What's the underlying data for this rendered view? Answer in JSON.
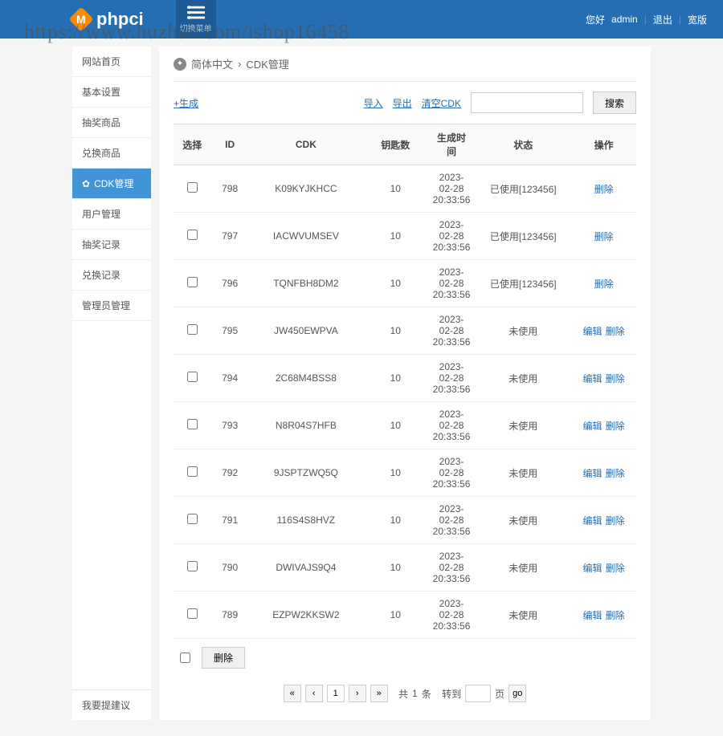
{
  "watermark": "https://www.huzhan.com/ishop16458",
  "header": {
    "logo_text": "phpci",
    "logo_icon": "M",
    "toggle_label": "切换菜单",
    "greeting": "您好",
    "username": "admin",
    "logout": "退出",
    "theme": "宽版"
  },
  "sidebar": {
    "items": [
      {
        "label": "网站首页"
      },
      {
        "label": "基本设置"
      },
      {
        "label": "抽奖商品"
      },
      {
        "label": "兑换商品"
      },
      {
        "label": "CDK管理",
        "active": true
      },
      {
        "label": "用户管理"
      },
      {
        "label": "抽奖记录"
      },
      {
        "label": "兑换记录"
      },
      {
        "label": "管理员管理"
      }
    ],
    "footer": "我要提建议"
  },
  "breadcrumb": {
    "root": "简体中文",
    "current": "CDK管理"
  },
  "toolbar": {
    "generate": "+生成",
    "import": "导入",
    "export": "导出",
    "clear": "清空CDK",
    "search_label": "搜索",
    "search_value": ""
  },
  "columns": {
    "select": "选择",
    "id": "ID",
    "cdk": "CDK",
    "keys": "钥匙数",
    "created": "生成时间",
    "status": "状态",
    "ops": "操作"
  },
  "rows": [
    {
      "id": "798",
      "cdk": "K09KYJKHCC",
      "keys": "10",
      "created": "2023-02-28 20:33:56",
      "status": "已使用[123456]",
      "ops": [
        "删除"
      ]
    },
    {
      "id": "797",
      "cdk": "IACWVUMSEV",
      "keys": "10",
      "created": "2023-02-28 20:33:56",
      "status": "已使用[123456]",
      "ops": [
        "删除"
      ]
    },
    {
      "id": "796",
      "cdk": "TQNFBH8DM2",
      "keys": "10",
      "created": "2023-02-28 20:33:56",
      "status": "已使用[123456]",
      "ops": [
        "删除"
      ]
    },
    {
      "id": "795",
      "cdk": "JW450EWPVA",
      "keys": "10",
      "created": "2023-02-28 20:33:56",
      "status": "未使用",
      "ops": [
        "编辑",
        "删除"
      ]
    },
    {
      "id": "794",
      "cdk": "2C68M4BSS8",
      "keys": "10",
      "created": "2023-02-28 20:33:56",
      "status": "未使用",
      "ops": [
        "编辑",
        "删除"
      ]
    },
    {
      "id": "793",
      "cdk": "N8R04S7HFB",
      "keys": "10",
      "created": "2023-02-28 20:33:56",
      "status": "未使用",
      "ops": [
        "编辑",
        "删除"
      ]
    },
    {
      "id": "792",
      "cdk": "9JSPTZWQ5Q",
      "keys": "10",
      "created": "2023-02-28 20:33:56",
      "status": "未使用",
      "ops": [
        "编辑",
        "删除"
      ]
    },
    {
      "id": "791",
      "cdk": "116S4S8HVZ",
      "keys": "10",
      "created": "2023-02-28 20:33:56",
      "status": "未使用",
      "ops": [
        "编辑",
        "删除"
      ]
    },
    {
      "id": "790",
      "cdk": "DWIVAJS9Q4",
      "keys": "10",
      "created": "2023-02-28 20:33:56",
      "status": "未使用",
      "ops": [
        "编辑",
        "删除"
      ]
    },
    {
      "id": "789",
      "cdk": "EZPW2KKSW2",
      "keys": "10",
      "created": "2023-02-28 20:33:56",
      "status": "未使用",
      "ops": [
        "编辑",
        "删除"
      ]
    }
  ],
  "batch": {
    "delete": "删除"
  },
  "pager": {
    "first": "«",
    "prev": "‹",
    "page": "1",
    "next": "›",
    "last": "»",
    "total_prefix": "共",
    "total_count": "1",
    "total_suffix": "条",
    "goto": "转到",
    "page_suffix": "页",
    "go": "go",
    "input_value": ""
  }
}
